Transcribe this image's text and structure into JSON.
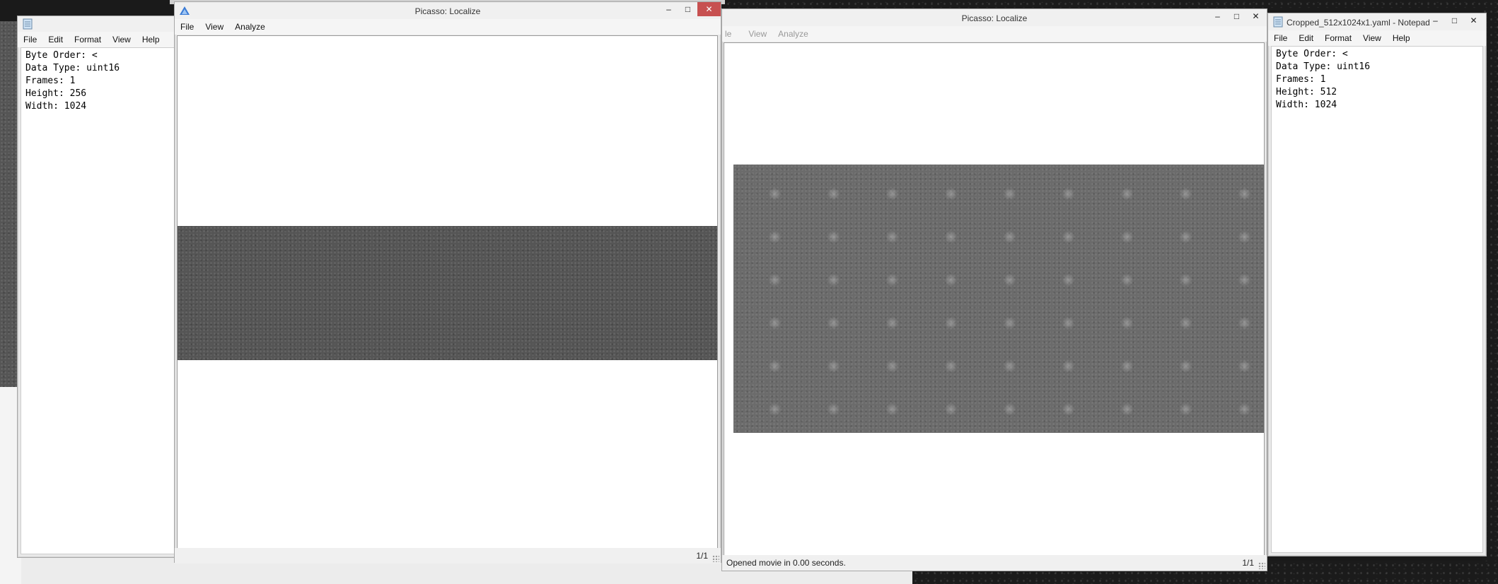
{
  "desktop": {},
  "left_notepad": {
    "title": "",
    "menu": [
      "File",
      "Edit",
      "Format",
      "View",
      "Help"
    ],
    "lines": [
      "Byte Order: <",
      "Data Type: uint16",
      "Frames: 1",
      "Height: 256",
      "Width: 1024"
    ]
  },
  "localize1": {
    "title": "Picasso: Localize",
    "menu": [
      "File",
      "View",
      "Analyze"
    ],
    "status_left": "",
    "frame_counter": "1/1"
  },
  "localize2": {
    "title": "Picasso: Localize",
    "menu": [
      "le",
      "View",
      "Analyze"
    ],
    "status_left": "Opened movie in 0.00 seconds.",
    "frame_counter": "1/1"
  },
  "right_notepad": {
    "title": "Cropped_512x1024x1.yaml - Notepad",
    "menu": [
      "File",
      "Edit",
      "Format",
      "View",
      "Help"
    ],
    "lines": [
      "Byte Order: <",
      "Data Type: uint16",
      "Frames: 1",
      "Height: 512",
      "Width: 1024"
    ]
  },
  "icons": {
    "notepad": "notepad-icon",
    "picasso": "picasso-icon",
    "minimize": "minimize-icon",
    "maximize": "maximize-icon",
    "close": "close-icon",
    "resize_grip": "resize-grip-icon"
  }
}
